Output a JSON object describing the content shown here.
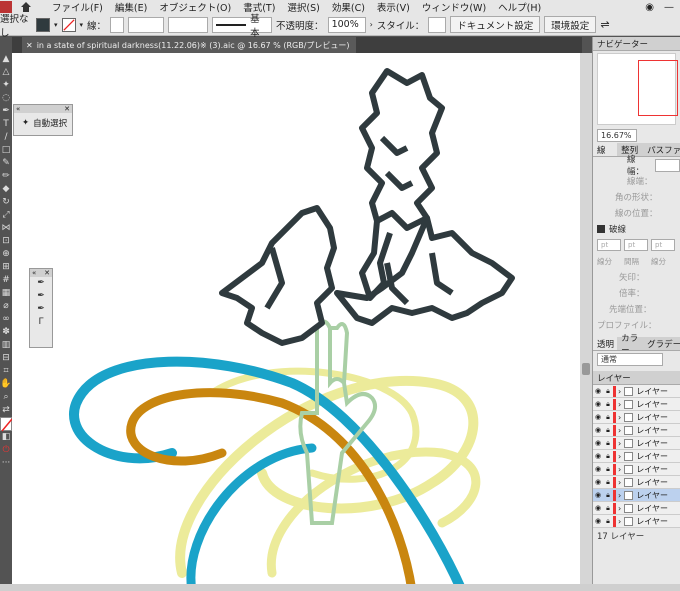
{
  "menubar": {
    "items": [
      "ファイル(F)",
      "編集(E)",
      "オブジェクト(O)",
      "書式(T)",
      "選択(S)",
      "効果(C)",
      "表示(V)",
      "ウィンドウ(W)",
      "ヘルプ(H)"
    ]
  },
  "controlbar": {
    "selection_status": "選択なし",
    "stroke_label": "線：",
    "stroke_style": "基本",
    "opacity_label": "不透明度：",
    "opacity_value": "100%",
    "style_label": "スタイル：",
    "doc_settings": "ドキュメント設定",
    "env_settings": "環境設定"
  },
  "document_tab": {
    "title": "in a state of spiritual darkness(11.22.06)※ (3).aic @ 16.67 % (RGB/プレビュー)"
  },
  "auto_select_panel": {
    "label": "自動選択"
  },
  "navigator": {
    "tab": "ナビゲーター",
    "zoom": "16.67%"
  },
  "stroke_panel": {
    "tabs": [
      "線",
      "整列",
      "パスファインダー"
    ],
    "rows": [
      "線幅：",
      "線端：",
      "角の形状：",
      "線の位置："
    ],
    "dashed": "破線",
    "dash_labels": [
      "線分",
      "間隔",
      "線分"
    ],
    "dash_placeholder": "pt",
    "arrow_label": "矢印：",
    "scale_label": "倍率：",
    "tip_label": "先端位置：",
    "profile_label": "プロファイル："
  },
  "transparency_panel": {
    "tabs": [
      "透明",
      "カラー",
      "グラデーション"
    ],
    "blend_mode": "通常"
  },
  "layers_panel": {
    "tab": "レイヤー",
    "layers": [
      {
        "name": "レイヤー",
        "selected": false
      },
      {
        "name": "レイヤー",
        "selected": false
      },
      {
        "name": "レイヤー",
        "selected": false
      },
      {
        "name": "レイヤー",
        "selected": false
      },
      {
        "name": "レイヤー",
        "selected": false
      },
      {
        "name": "レイヤー",
        "selected": false
      },
      {
        "name": "レイヤー",
        "selected": false
      },
      {
        "name": "レイヤー",
        "selected": false
      },
      {
        "name": "レイヤー",
        "selected": true
      },
      {
        "name": "レイヤー",
        "selected": false
      },
      {
        "name": "レイヤー",
        "selected": false
      }
    ],
    "count": "17 レイヤー"
  },
  "colors": {
    "dark_gray": "#2f3a3e",
    "teal_blue": "#1aa3c9",
    "amber": "#c9860f",
    "pale_yellow": "#eceb9a",
    "sage_green": "#a9cfa5"
  }
}
